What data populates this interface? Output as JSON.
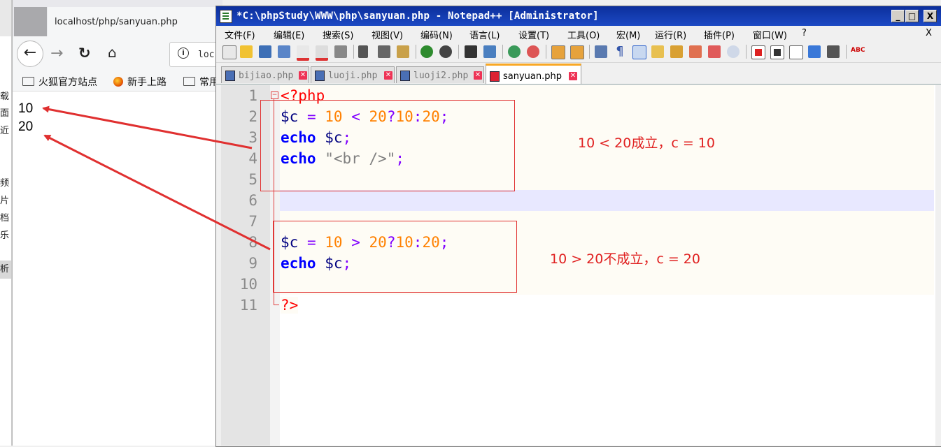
{
  "left_strip": {
    "chars": [
      "载",
      "面",
      "近",
      "频",
      "片",
      "档",
      "乐",
      "析"
    ]
  },
  "browser": {
    "tab_title": "localhost/php/sanyuan.php",
    "url_partial": "loc",
    "bookmarks": [
      {
        "label": "火狐官方站点",
        "icon": "folder-icon"
      },
      {
        "label": "新手上路",
        "icon": "firefox-icon"
      },
      {
        "label": "常用",
        "icon": "folder-icon"
      }
    ],
    "output_lines": [
      "10",
      "20"
    ]
  },
  "notepad": {
    "title": "*C:\\phpStudy\\WWW\\php\\sanyuan.php - Notepad++ [Administrator]",
    "window_buttons": {
      "min": "_",
      "max": "□",
      "close": "X"
    },
    "menu": [
      "文件(F)",
      "编辑(E)",
      "搜索(S)",
      "视图(V)",
      "编码(N)",
      "语言(L)",
      "设置(T)",
      "工具(O)",
      "宏(M)",
      "运行(R)",
      "插件(P)",
      "窗口(W)",
      "?"
    ],
    "menu_close": "X",
    "tabs": [
      {
        "name": "bijiao.php",
        "active": false
      },
      {
        "name": "luoji.php",
        "active": false
      },
      {
        "name": "luoji2.php",
        "active": false
      },
      {
        "name": "sanyuan.php",
        "active": true
      }
    ],
    "tab_close_glyph": "✕",
    "line_numbers": [
      "1",
      "2",
      "3",
      "4",
      "5",
      "6",
      "7",
      "8",
      "9",
      "10",
      "11"
    ],
    "code": {
      "l1_open": "<?php",
      "l2": {
        "var": "$c",
        "eq": "=",
        "a": "10",
        "op": "<",
        "b": "20",
        "q": "?",
        "t": "10",
        "colon": ":",
        "f": "20",
        "semi": ";"
      },
      "l3": {
        "kw": "echo",
        "var": "$c",
        "semi": ";"
      },
      "l4": {
        "kw": "echo",
        "str_open": "\"",
        "str_body": "<br />",
        "str_close": "\"",
        "semi": ";"
      },
      "l8": {
        "var": "$c",
        "eq": "=",
        "a": "10",
        "op": ">",
        "b": "20",
        "q": "?",
        "t": "10",
        "colon": ":",
        "f": "20",
        "semi": ";"
      },
      "l9": {
        "kw": "echo",
        "var": "$c",
        "semi": ";"
      },
      "l11_close": "?>"
    },
    "annotations": [
      "10 < 20成立，c = 10",
      "10 > 20不成立，c = 20"
    ]
  },
  "colors": {
    "annotation": "#e02020",
    "titlebar": "#0c2f9c",
    "keyword": "#0000ff",
    "number": "#ff8000",
    "operator": "#8000ff",
    "variable": "#000080"
  }
}
